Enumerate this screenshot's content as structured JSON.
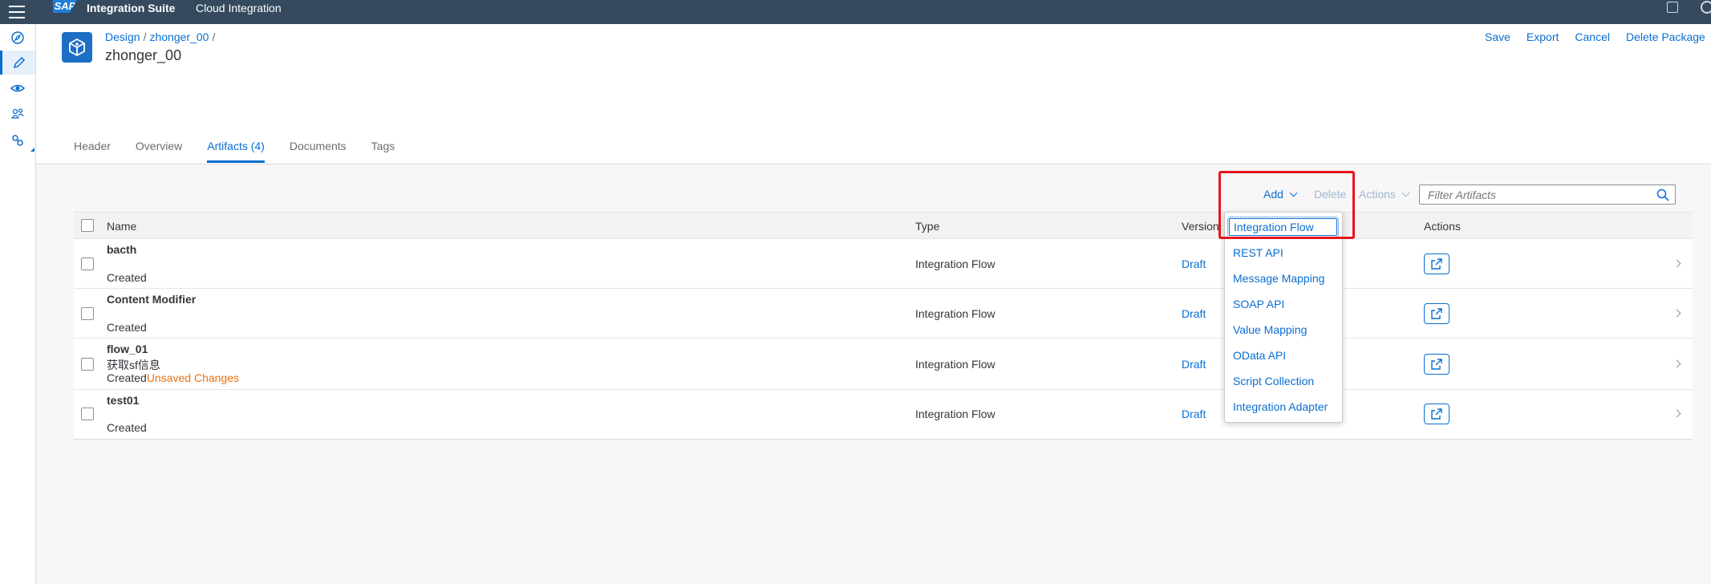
{
  "shell": {
    "product": "Integration Suite",
    "subtitle": "Cloud Integration",
    "logo": "SAP"
  },
  "nav": {
    "items": [
      {
        "icon": "discover-icon"
      },
      {
        "icon": "design-pencil-icon",
        "active": true
      },
      {
        "icon": "monitor-eye-icon"
      },
      {
        "icon": "people-icon"
      },
      {
        "icon": "settings-gears-icon"
      }
    ]
  },
  "header": {
    "breadcrumb": [
      "Design",
      "zhonger_00"
    ],
    "title": "zhonger_00",
    "actions": [
      "Save",
      "Export",
      "Cancel",
      "Delete Package"
    ]
  },
  "tabs": [
    {
      "label": "Header"
    },
    {
      "label": "Overview"
    },
    {
      "label": "Artifacts (4)",
      "selected": true
    },
    {
      "label": "Documents"
    },
    {
      "label": "Tags"
    }
  ],
  "toolbar": {
    "add": "Add",
    "delete": "Delete",
    "actions": "Actions",
    "filter_placeholder": "Filter Artifacts"
  },
  "table": {
    "columns": [
      "Name",
      "Type",
      "Version",
      "Actions"
    ],
    "rows": [
      {
        "name": "bacth",
        "desc": "",
        "status": "Created",
        "unsaved": "",
        "type": "Integration Flow",
        "version": "Draft"
      },
      {
        "name": "Content Modifier",
        "desc": "",
        "status": "Created",
        "unsaved": "",
        "type": "Integration Flow",
        "version": "Draft"
      },
      {
        "name": "flow_01",
        "desc": "获取sf信息",
        "status": "Created",
        "unsaved": "Unsaved Changes",
        "type": "Integration Flow",
        "version": "Draft"
      },
      {
        "name": "test01",
        "desc": "",
        "status": "Created",
        "unsaved": "",
        "type": "Integration Flow",
        "version": "Draft"
      }
    ]
  },
  "add_menu": {
    "items": [
      "Integration Flow",
      "REST API",
      "Message Mapping",
      "SOAP API",
      "Value Mapping",
      "OData API",
      "Script Collection",
      "Integration Adapter"
    ]
  },
  "colors": {
    "shell": "#354a5f",
    "accent": "#0a6ed1",
    "warning": "#e9730c",
    "highlight": "#e8141b"
  }
}
